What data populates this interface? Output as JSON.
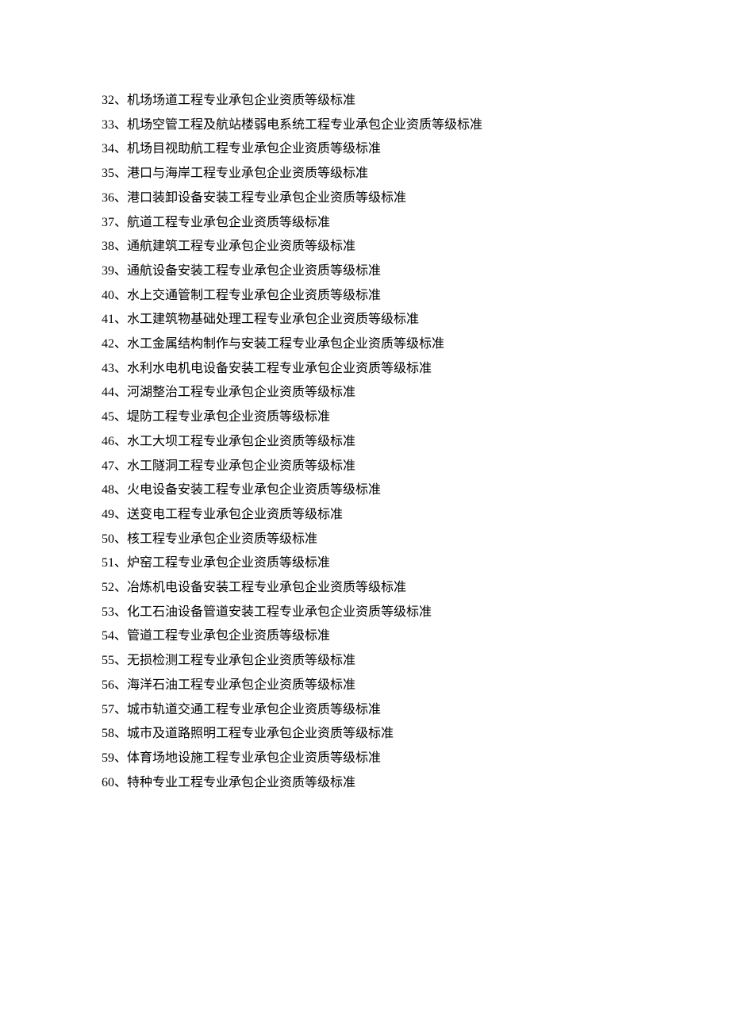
{
  "items": [
    "32、机场场道工程专业承包企业资质等级标准",
    "33、机场空管工程及航站楼弱电系统工程专业承包企业资质等级标准",
    "34、机场目视助航工程专业承包企业资质等级标准",
    "35、港口与海岸工程专业承包企业资质等级标准",
    "36、港口装卸设备安装工程专业承包企业资质等级标准",
    "37、航道工程专业承包企业资质等级标准",
    "38、通航建筑工程专业承包企业资质等级标准",
    "39、通航设备安装工程专业承包企业资质等级标准",
    "40、水上交通管制工程专业承包企业资质等级标准",
    "41、水工建筑物基础处理工程专业承包企业资质等级标准",
    "42、水工金属结构制作与安装工程专业承包企业资质等级标准",
    "43、水利水电机电设备安装工程专业承包企业资质等级标准",
    "44、河湖整治工程专业承包企业资质等级标准",
    "45、堤防工程专业承包企业资质等级标准",
    "46、水工大坝工程专业承包企业资质等级标准",
    "47、水工隧洞工程专业承包企业资质等级标准",
    "48、火电设备安装工程专业承包企业资质等级标准",
    "49、送变电工程专业承包企业资质等级标准",
    "50、核工程专业承包企业资质等级标准",
    "51、炉窑工程专业承包企业资质等级标准",
    "52、冶炼机电设备安装工程专业承包企业资质等级标准",
    "53、化工石油设备管道安装工程专业承包企业资质等级标准",
    "54、管道工程专业承包企业资质等级标准",
    "55、无损检测工程专业承包企业资质等级标准",
    "56、海洋石油工程专业承包企业资质等级标准",
    "57、城市轨道交通工程专业承包企业资质等级标准",
    "58、城市及道路照明工程专业承包企业资质等级标准",
    "59、体育场地设施工程专业承包企业资质等级标准",
    "60、特种专业工程专业承包企业资质等级标准"
  ]
}
